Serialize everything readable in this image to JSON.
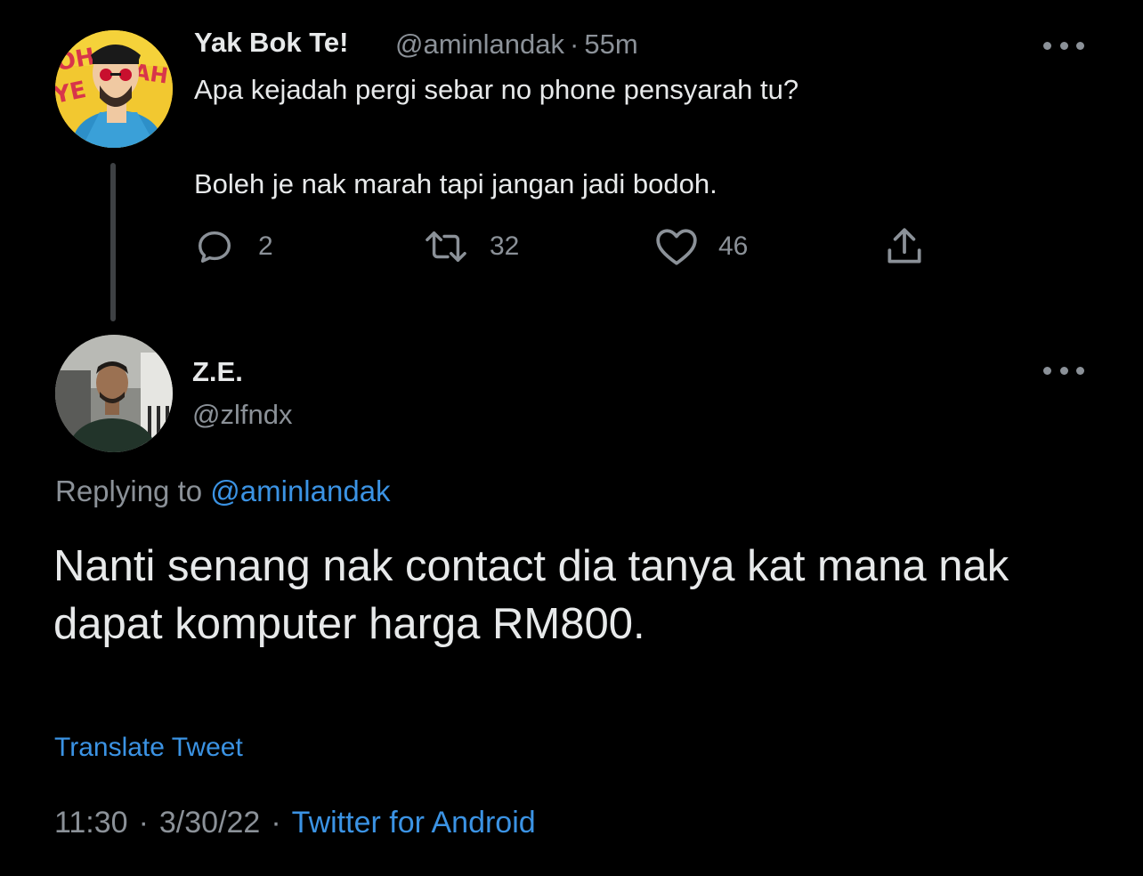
{
  "parent_tweet": {
    "display_name": "Yak Bok Te!",
    "handle": "@aminlandak",
    "separator": "·",
    "time_ago": "55m",
    "text_line1": "Apa kejadah pergi sebar no phone pensyarah tu?",
    "text_line2": "Boleh je nak marah tapi jangan jadi bodoh.",
    "replies": "2",
    "retweets": "32",
    "likes": "46",
    "avatar_text": "OH YEAH"
  },
  "main_tweet": {
    "display_name": "Z.E.",
    "handle": "@zlfndx",
    "replying_label": "Replying to",
    "replying_handle": "@aminlandak",
    "text": "Nanti senang nak contact dia tanya kat mana nak dapat komputer harga RM800.",
    "translate_label": "Translate Tweet",
    "time": "11:30",
    "separator": "·",
    "date": "3/30/22",
    "source": "Twitter for Android"
  },
  "icons": {
    "reply": "reply-icon",
    "retweet": "retweet-icon",
    "like": "heart-icon",
    "share": "share-icon",
    "more": "more-options-icon"
  },
  "colors": {
    "background": "#000000",
    "text_primary": "#e7e9ea",
    "text_secondary": "#8b9198",
    "link": "#3b93e4",
    "thread_line": "#3e4144"
  }
}
